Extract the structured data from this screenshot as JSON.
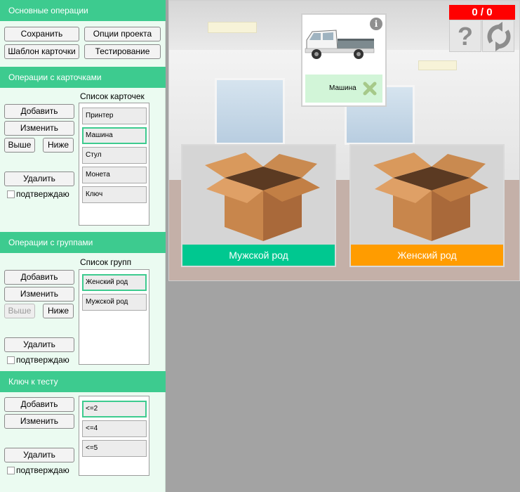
{
  "sections": {
    "basic": {
      "header": "Основные операции",
      "save": "Сохранить",
      "project_options": "Опции проекта",
      "card_template": "Шаблон карточки",
      "testing": "Тестирование"
    },
    "cards": {
      "header": "Операции с карточками",
      "list_title": "Список карточек",
      "add": "Добавить",
      "edit": "Изменить",
      "up": "Выше",
      "down": "Ниже",
      "delete": "Удалить",
      "confirm": "подтверждаю",
      "items": [
        "Принтер",
        "Машина",
        "Стул",
        "Монета",
        "Ключ"
      ],
      "selected_index": 1
    },
    "groups": {
      "header": "Операции с группами",
      "list_title": "Список групп",
      "add": "Добавить",
      "edit": "Изменить",
      "up": "Выше",
      "down": "Ниже",
      "delete": "Удалить",
      "confirm": "подтверждаю",
      "items": [
        "Женский род",
        "Мужской род"
      ],
      "selected_index": 0
    },
    "key": {
      "header": "Ключ к тесту",
      "add": "Добавить",
      "edit": "Изменить",
      "delete": "Удалить",
      "confirm": "подтверждаю",
      "items": [
        "<=2",
        "<=4",
        "<=5"
      ],
      "selected_index": 0
    }
  },
  "stage": {
    "score": "0 / 0",
    "card_label": "Машина",
    "groups": [
      {
        "label": "Мужской род",
        "color": "#00c890"
      },
      {
        "label": "Женский род",
        "color": "#ff9c00"
      }
    ],
    "icons": {
      "help": "question-icon",
      "reset": "refresh-icon",
      "info": "info-icon"
    }
  },
  "colors": {
    "accent": "#3dcb8f",
    "sidebar_bg": "#ebfbf1",
    "score_bg": "#ff0000"
  }
}
